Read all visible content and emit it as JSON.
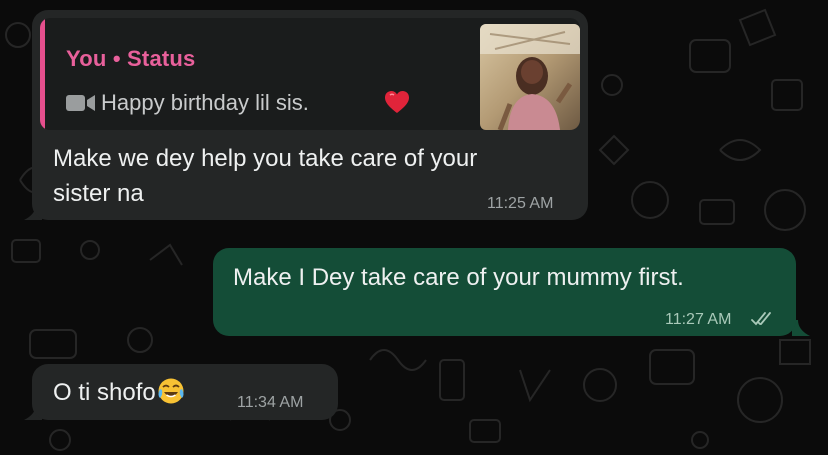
{
  "messages": [
    {
      "direction": "incoming",
      "reply_to": {
        "author": "You • Status",
        "media_icon": "video-camera-icon",
        "text": "Happy birthday lil sis.",
        "emoji": "red-heart-icon"
      },
      "lines": [
        "Make we dey help you take care of your",
        "sister na"
      ],
      "time": "11:25 AM"
    },
    {
      "direction": "outgoing",
      "lines": [
        "Make I Dey take care of your mummy first."
      ],
      "time": "11:27 AM",
      "status_icon": "double-check-read-icon"
    },
    {
      "direction": "incoming",
      "lines": [
        "O ti shofo"
      ],
      "emoji": "face-with-tears-of-joy-icon",
      "time": "11:34 AM"
    }
  ],
  "colors": {
    "chat_background": "#0b0b0b",
    "incoming_bubble": "#242626",
    "outgoing_bubble": "#144d37",
    "quote_accent": "#e54f8d",
    "read_ticks": "#a9c9b9"
  }
}
